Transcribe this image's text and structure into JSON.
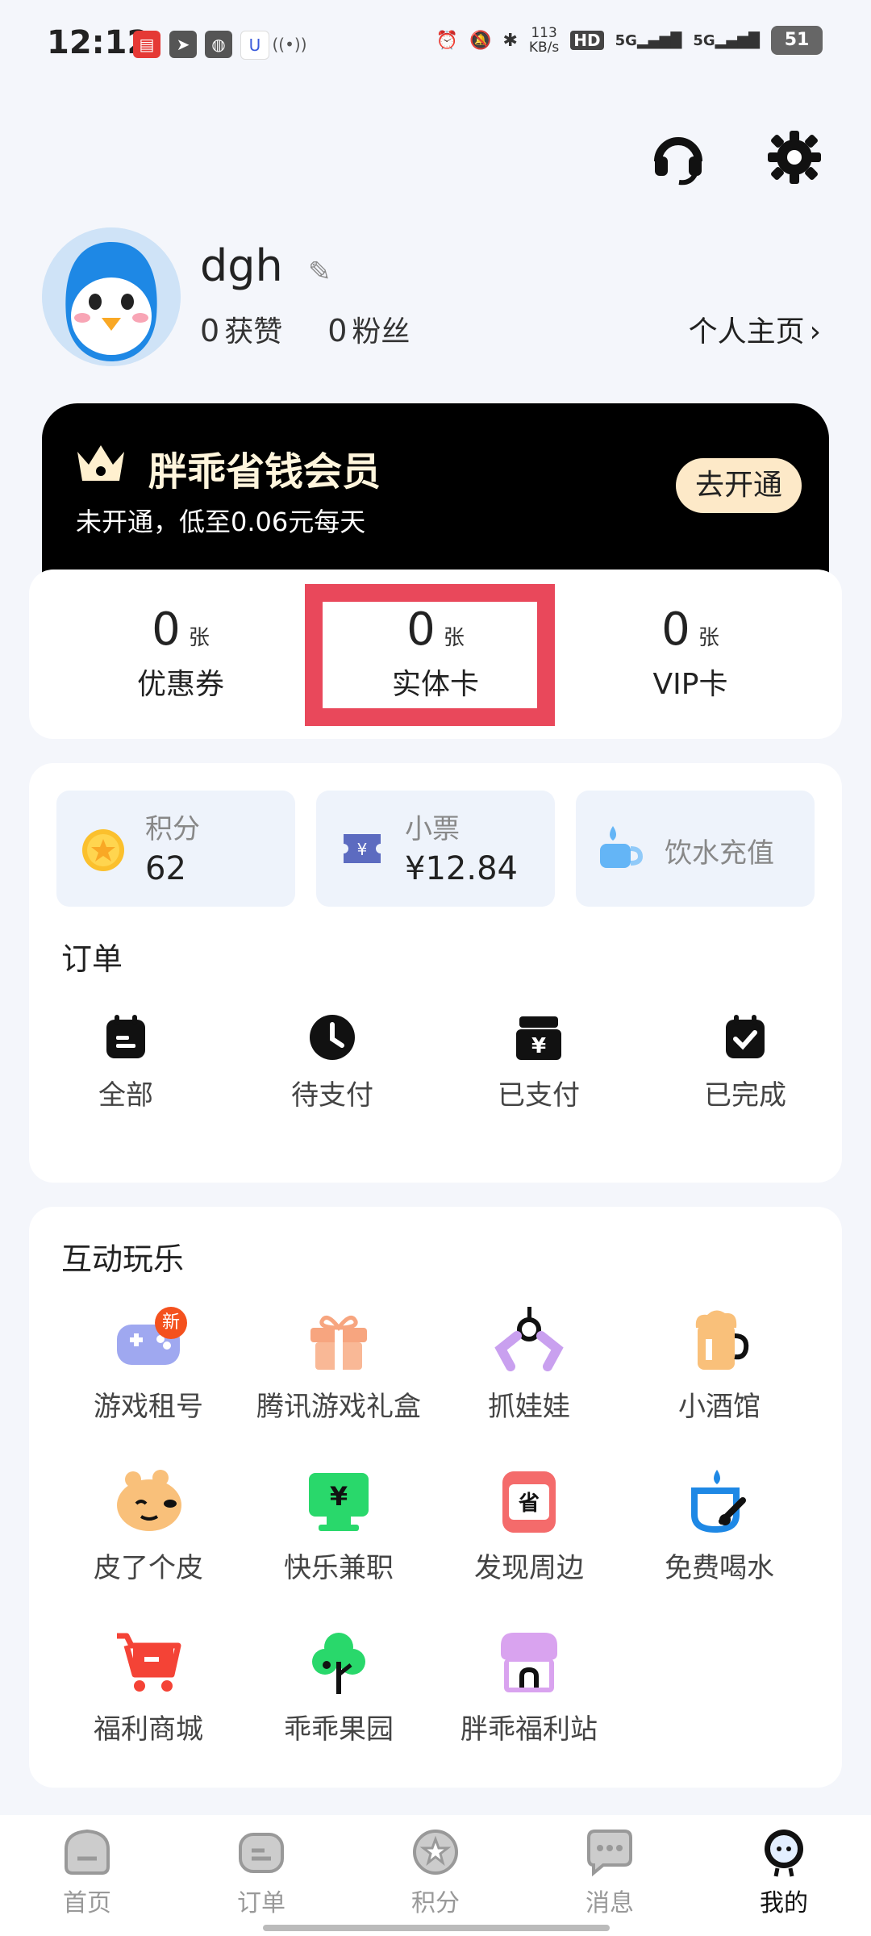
{
  "status_bar": {
    "time": "12:12",
    "net_speed_value": "113",
    "net_speed_unit": "KB/s",
    "hd_label": "HD",
    "signal1": "5G",
    "signal2": "5G",
    "battery": "51"
  },
  "profile": {
    "username": "dgh",
    "likes_count": "0",
    "likes_label": "获赞",
    "fans_count": "0",
    "fans_label": "粉丝",
    "homepage_link": "个人主页"
  },
  "vip": {
    "title": "胖乖省钱会员",
    "subtitle": "未开通，低至0.06元每天",
    "button": "去开通"
  },
  "cards": [
    {
      "count": "0",
      "unit": "张",
      "label": "优惠券"
    },
    {
      "count": "0",
      "unit": "张",
      "label": "实体卡"
    },
    {
      "count": "0",
      "unit": "张",
      "label": "VIP卡"
    }
  ],
  "tiles": {
    "points_title": "积分",
    "points_value": "62",
    "ticket_title": "小票",
    "ticket_value": "¥12.84",
    "water_title": "饮水充值"
  },
  "orders": {
    "title": "订单",
    "items": [
      {
        "label": "全部",
        "icon": "order-all-icon"
      },
      {
        "label": "待支付",
        "icon": "clock-icon"
      },
      {
        "label": "已支付",
        "icon": "paid-icon"
      },
      {
        "label": "已完成",
        "icon": "check-icon"
      }
    ]
  },
  "fun": {
    "title": "互动玩乐",
    "badge_new": "新",
    "items": [
      {
        "label": "游戏租号",
        "icon": "gamepad-icon"
      },
      {
        "label": "腾讯游戏礼盒",
        "icon": "gift-box-icon"
      },
      {
        "label": "抓娃娃",
        "icon": "claw-icon"
      },
      {
        "label": "小酒馆",
        "icon": "beer-icon"
      },
      {
        "label": "皮了个皮",
        "icon": "face-icon"
      },
      {
        "label": "快乐兼职",
        "icon": "monitor-yen-icon"
      },
      {
        "label": "发现周边",
        "icon": "save-shop-icon"
      },
      {
        "label": "免费喝水",
        "icon": "cup-water-icon"
      },
      {
        "label": "福利商城",
        "icon": "cart-icon"
      },
      {
        "label": "乖乖果园",
        "icon": "tree-icon"
      },
      {
        "label": "胖乖福利站",
        "icon": "store-icon"
      }
    ]
  },
  "tabbar": [
    {
      "label": "首页",
      "icon": "home-icon"
    },
    {
      "label": "订单",
      "icon": "orders-tab-icon"
    },
    {
      "label": "积分",
      "icon": "points-tab-icon"
    },
    {
      "label": "消息",
      "icon": "message-icon"
    },
    {
      "label": "我的",
      "icon": "me-icon"
    }
  ],
  "colors": {
    "accent_red": "#e9485b",
    "vip_bg": "#000000",
    "vip_button": "#fde9c8",
    "page_bg": "#f4f6fb"
  }
}
